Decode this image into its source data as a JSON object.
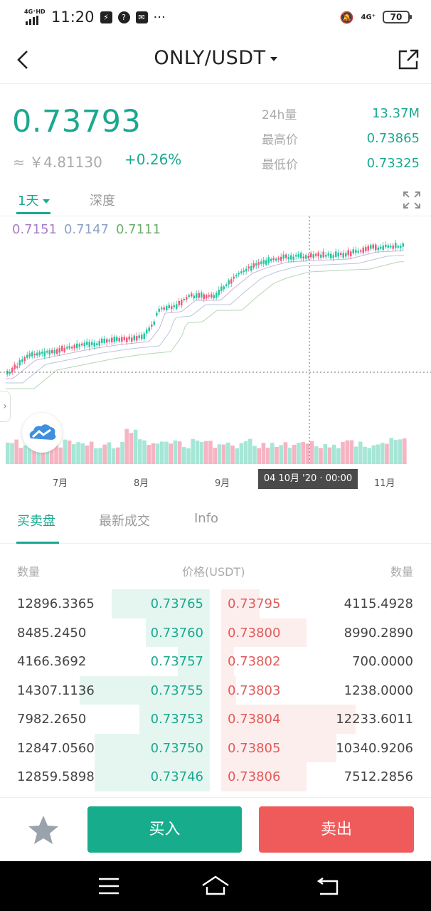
{
  "status_bar": {
    "network": "4G⁺HD",
    "time": "11:20",
    "network_right": "4G⁺",
    "battery": "70"
  },
  "header": {
    "title": "ONLY/USDT"
  },
  "price": {
    "last": "0.73793",
    "cny": "≈ ￥4.81130",
    "change": "+0.26%"
  },
  "stats": [
    {
      "label": "24h量",
      "value": "13.37M"
    },
    {
      "label": "最高价",
      "value": "0.73865"
    },
    {
      "label": "最低价",
      "value": "0.73325"
    }
  ],
  "chart_tabs": {
    "interval": "1天",
    "depth": "深度"
  },
  "ma_legend": [
    "0.7151",
    "0.7147",
    "0.7111"
  ],
  "chart_axis": {
    "months": [
      "7月",
      "8月",
      "9月",
      "11月"
    ],
    "crosshair_label": "04 10月 '20 · 00:00"
  },
  "book_tabs": [
    "买卖盘",
    "最新成交",
    "Info"
  ],
  "order_book": {
    "headers": {
      "bid_qty": "数量",
      "price": "价格(USDT)",
      "ask_qty": "数量"
    },
    "rows": [
      {
        "bid_qty": "12896.3365",
        "bid_price": "0.73765",
        "ask_price": "0.73795",
        "ask_qty": "4115.4928",
        "bid_depth": 0.46,
        "ask_depth": 0.18
      },
      {
        "bid_qty": "8485.2450",
        "bid_price": "0.73760",
        "ask_price": "0.73800",
        "ask_qty": "8990.2890",
        "bid_depth": 0.3,
        "ask_depth": 0.4
      },
      {
        "bid_qty": "4166.3692",
        "bid_price": "0.73757",
        "ask_price": "0.73802",
        "ask_qty": "700.0000",
        "bid_depth": 0.15,
        "ask_depth": 0.06
      },
      {
        "bid_qty": "14307.1136",
        "bid_price": "0.73755",
        "ask_price": "0.73803",
        "ask_qty": "1238.0000",
        "bid_depth": 0.61,
        "ask_depth": 0.07
      },
      {
        "bid_qty": "7982.2650",
        "bid_price": "0.73753",
        "ask_price": "0.73804",
        "ask_qty": "12233.6011",
        "bid_depth": 0.33,
        "ask_depth": 0.63
      },
      {
        "bid_qty": "12847.0560",
        "bid_price": "0.73750",
        "ask_price": "0.73805",
        "ask_qty": "10340.9206",
        "bid_depth": 0.54,
        "ask_depth": 0.54
      },
      {
        "bid_qty": "12859.5898",
        "bid_price": "0.73746",
        "ask_price": "0.73806",
        "ask_qty": "7512.2856",
        "bid_depth": 0.54,
        "ask_depth": 0.4
      }
    ]
  },
  "actions": {
    "buy": "买入",
    "sell": "卖出"
  },
  "colors": {
    "up": "#1aa88f",
    "down": "#e35a5a",
    "buy_button": "#17ad8c",
    "sell_button": "#ef5b5b"
  },
  "icons": {
    "back": "chevron-left-icon",
    "share": "share-external-icon",
    "fullscreen": "expand-icon",
    "favorite": "star-icon",
    "logo": "cloud-logo-icon"
  }
}
